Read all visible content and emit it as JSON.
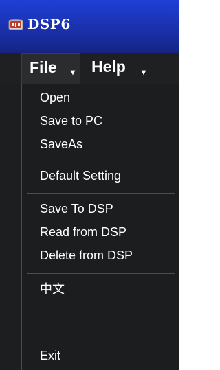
{
  "window": {
    "title": "DSP6",
    "app_icon": "dsp-app-icon"
  },
  "menubar": {
    "file_label": "File",
    "help_label": "Help"
  },
  "file_menu": {
    "items": [
      {
        "label": "Open"
      },
      {
        "label": "Save to PC"
      },
      {
        "label": "SaveAs"
      },
      {
        "label": "Default Setting"
      },
      {
        "label": "Save To DSP"
      },
      {
        "label": "Read from DSP"
      },
      {
        "label": "Delete from DSP"
      },
      {
        "label": "中文"
      },
      {
        "label": "Exit"
      }
    ]
  },
  "colors": {
    "titlebar": "#1f3fd6",
    "menu_background": "#1b1d1f",
    "text": "#ffffff",
    "separator": "#4a4c4e"
  }
}
